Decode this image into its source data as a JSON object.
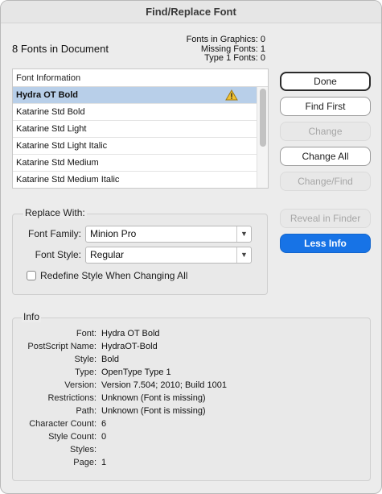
{
  "window": {
    "title": "Find/Replace Font"
  },
  "summary": {
    "fonts_in_document": "8 Fonts in Document",
    "fonts_in_graphics": "Fonts in Graphics: 0",
    "missing_fonts": "Missing Fonts: 1",
    "type1_fonts": "Type 1 Fonts: 0"
  },
  "font_list": {
    "header": "Font Information",
    "items": [
      {
        "name": "Hydra OT Bold",
        "warning_icon": "warning-triangle-icon"
      },
      {
        "name": "Katarine Std Bold"
      },
      {
        "name": "Katarine Std Light"
      },
      {
        "name": "Katarine Std Light Italic"
      },
      {
        "name": "Katarine Std Medium"
      },
      {
        "name": "Katarine Std Medium Italic"
      }
    ]
  },
  "buttons": {
    "done": "Done",
    "find_first": "Find First",
    "change": "Change",
    "change_all": "Change All",
    "change_find": "Change/Find",
    "reveal_in_finder": "Reveal in Finder",
    "less_info": "Less Info"
  },
  "replace_with": {
    "label": "Replace With:",
    "font_family_label": "Font Family:",
    "font_family_value": "Minion Pro",
    "font_style_label": "Font Style:",
    "font_style_value": "Regular",
    "redefine_label": "Redefine Style When Changing All"
  },
  "info": {
    "label": "Info",
    "rows": [
      {
        "label": "Font:",
        "value": "Hydra OT Bold"
      },
      {
        "label": "PostScript Name:",
        "value": "HydraOT-Bold"
      },
      {
        "label": "Style:",
        "value": "Bold"
      },
      {
        "label": "Type:",
        "value": "OpenType Type 1"
      },
      {
        "label": "Version:",
        "value": "Version 7.504; 2010; Build 1001"
      },
      {
        "label": "Restrictions:",
        "value": "Unknown (Font is missing)"
      },
      {
        "label": "Path:",
        "value": "Unknown (Font is missing)"
      },
      {
        "label": "Character Count:",
        "value": "6"
      },
      {
        "label": "Style Count:",
        "value": "0"
      },
      {
        "label": "Styles:",
        "value": ""
      },
      {
        "label": "Page:",
        "value": "1"
      }
    ]
  },
  "colors": {
    "accent": "#1773e6",
    "selection": "#b8cfe9",
    "warning": "#f2c230"
  }
}
